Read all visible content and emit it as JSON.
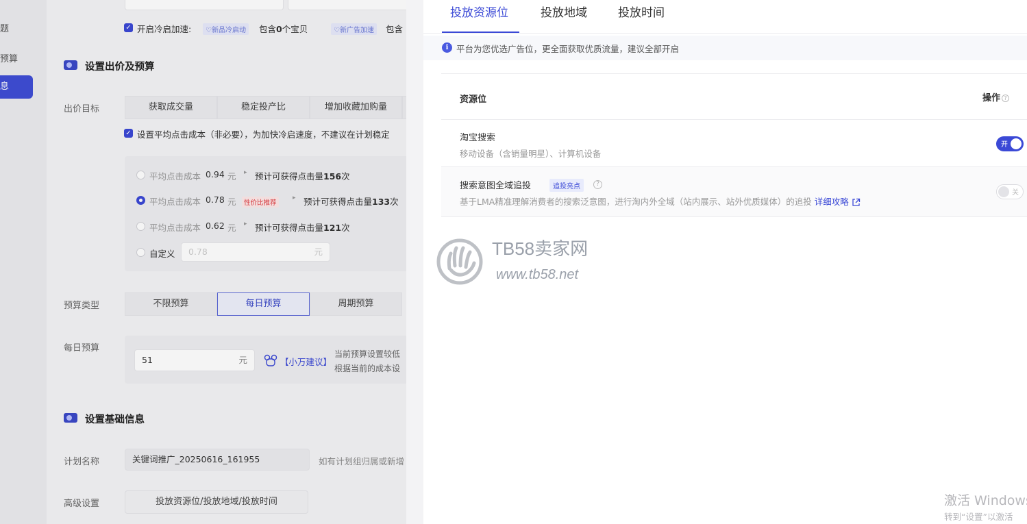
{
  "sidebar": {
    "items": [
      "题",
      "预算",
      "息"
    ]
  },
  "form": {
    "cold_start": {
      "label": "开启冷启加速:",
      "tag_new_product": "♡新品冷启动",
      "new_product_text_pre": "包含",
      "new_product_count": "0",
      "new_product_text_post": "个宝贝",
      "tag_new_ad": "♡新广告加速",
      "new_ad_text": "包含"
    },
    "bid_section": {
      "title": "设置出价及预算",
      "bid_target_label": "出价目标",
      "bid_targets": [
        "获取成交量",
        "稳定投产比",
        "增加收藏加购量"
      ],
      "avg_click_checkbox_text": "设置平均点击成本（非必要），为加快冷启速度，不建议在计划稳定",
      "options": [
        {
          "prefix": "平均点击成本",
          "value": "0.94",
          "unit": "元",
          "arrow": "▸",
          "est": "预计可获得点击量",
          "clicks": "156",
          "suffix": "次",
          "tag": ""
        },
        {
          "prefix": "平均点击成本",
          "value": "0.78",
          "unit": "元",
          "arrow": "▸",
          "est": "预计可获得点击量",
          "clicks": "133",
          "suffix": "次",
          "tag": "性价比推荐"
        },
        {
          "prefix": "平均点击成本",
          "value": "0.62",
          "unit": "元",
          "arrow": "▸",
          "est": "预计可获得点击量",
          "clicks": "121",
          "suffix": "次",
          "tag": ""
        }
      ],
      "custom_label": "自定义",
      "custom_placeholder": "0.78",
      "custom_unit": "元",
      "budget_type_label": "预算类型",
      "budget_types": [
        "不限预算",
        "每日预算",
        "周期预算"
      ],
      "daily_budget_label": "每日预算",
      "daily_budget_value": "51",
      "daily_budget_unit": "元",
      "advice_label": "【小万建议】",
      "advice_line1": "当前预算设置较低",
      "advice_line2": "根据当前的成本设"
    },
    "basic_section": {
      "title": "设置基础信息",
      "plan_name_label": "计划名称",
      "plan_name_value": "关键词推广_20250616_161955",
      "plan_name_hint": "如有计划组归属或新增",
      "advanced_label": "高级设置",
      "advanced_button": "投放资源位/投放地域/投放时间"
    }
  },
  "drawer": {
    "tabs": [
      "投放资源位",
      "投放地域",
      "投放时间"
    ],
    "active_tab": 0,
    "notice": "平台为您优选广告位，更全面获取优质流量，建议全部开启",
    "table": {
      "col_resource": "资源位",
      "col_action": "操作",
      "rows": [
        {
          "title": "淘宝搜索",
          "tag": "",
          "desc": "移动设备（含销量明星）、计算机设备",
          "link": "",
          "switch_on": true,
          "switch_text": "开"
        },
        {
          "title": "搜索意图全域追投",
          "tag": "追投亮点",
          "desc": "基于LMA精准理解消费者的搜索泛意图，进行淘内外全域（站内展示、站外优质媒体）的追投",
          "link": "详细攻略",
          "switch_on": false,
          "switch_text": "关"
        }
      ]
    }
  },
  "watermark": {
    "name": "TB58卖家网",
    "url": "www.tb58.net"
  },
  "windows_activation": {
    "line1": "激活 Windows",
    "line2": "转到“设置”以激活"
  },
  "colors": {
    "accent": "#3b49d6",
    "danger": "#e0393e"
  }
}
